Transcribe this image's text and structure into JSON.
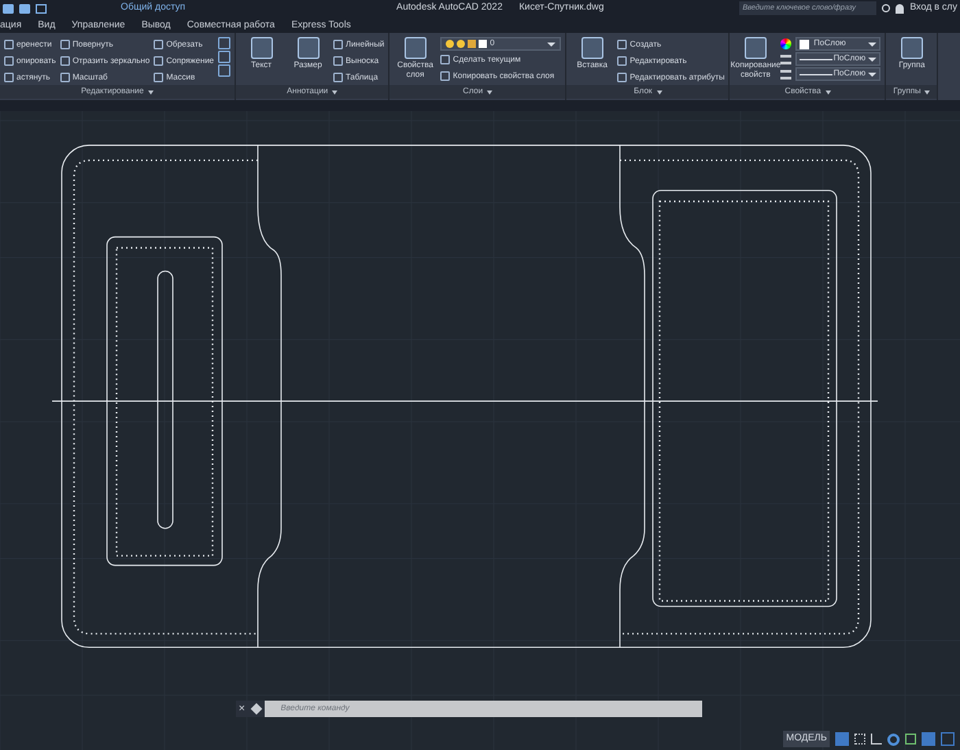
{
  "title_bar": {
    "quick_access": "Общий доступ",
    "title": "Autodesk AutoCAD 2022",
    "filename": "Кисет-Спутник.dwg",
    "search": {
      "placeholder": "Введите ключевое слово/фразу"
    },
    "sign_in": "Вход в слу"
  },
  "ribbon_tabs": [
    {
      "label": "ация"
    },
    {
      "label": "Вид"
    },
    {
      "label": "Управление"
    },
    {
      "label": "Вывод"
    },
    {
      "label": "Совместная работа"
    },
    {
      "label": "Express Tools"
    }
  ],
  "panels": [
    {
      "title": "Редактирование",
      "columns": [
        [
          {
            "kind": "small",
            "label": "еренести"
          },
          {
            "kind": "small",
            "label": "опировать"
          },
          {
            "kind": "small",
            "label": "астянуть"
          }
        ],
        [
          {
            "kind": "small",
            "label": "Повернуть"
          },
          {
            "kind": "small",
            "label": "Отразить зеркально"
          },
          {
            "kind": "small",
            "label": "Масштаб"
          }
        ],
        [
          {
            "kind": "small",
            "label": "Обрезать"
          },
          {
            "kind": "small",
            "label": "Сопряжение"
          },
          {
            "kind": "small",
            "label": "Массив"
          }
        ],
        [
          {
            "kind": "icon"
          },
          {
            "kind": "icon"
          },
          {
            "kind": "icon"
          }
        ]
      ]
    },
    {
      "title": "Аннотации",
      "columns": [
        [
          {
            "kind": "large",
            "label": "Текст"
          }
        ],
        [
          {
            "kind": "large",
            "label": "Размер"
          }
        ],
        [
          {
            "kind": "small",
            "label": "Линейный"
          },
          {
            "kind": "small",
            "label": "Выноска"
          },
          {
            "kind": "small",
            "label": "Таблица"
          }
        ]
      ]
    },
    {
      "title": "Слои",
      "columns": [
        [
          {
            "kind": "large",
            "label": "Свойства слоя"
          }
        ],
        [
          {
            "kind": "dropdown",
            "label": "0"
          },
          {
            "kind": "small",
            "label": "Сделать текущим"
          },
          {
            "kind": "small",
            "label": "Копировать свойства слоя"
          }
        ]
      ]
    },
    {
      "title": "Блок",
      "columns": [
        [
          {
            "kind": "large",
            "label": "Вставка"
          }
        ],
        [
          {
            "kind": "small",
            "label": "Создать"
          },
          {
            "kind": "small",
            "label": "Редактировать"
          },
          {
            "kind": "small",
            "label": "Редактировать атрибуты"
          }
        ]
      ]
    },
    {
      "title": "Свойства",
      "columns": [
        [
          {
            "kind": "large",
            "label": "Копирование свойств"
          }
        ],
        [
          {
            "kind": "color_dropdown",
            "label": "ПоСлою"
          },
          {
            "kind": "line_dropdown",
            "label": "ПоСлою"
          },
          {
            "kind": "line_dropdown",
            "label": "ПоСлою"
          }
        ]
      ]
    },
    {
      "title": "Группы",
      "columns": [
        [
          {
            "kind": "large",
            "label": "Группа"
          }
        ]
      ]
    }
  ],
  "command_line": {
    "close": "×",
    "placeholder": "Введите команду"
  },
  "status_bar": {
    "model": "МОДЕЛЬ"
  }
}
